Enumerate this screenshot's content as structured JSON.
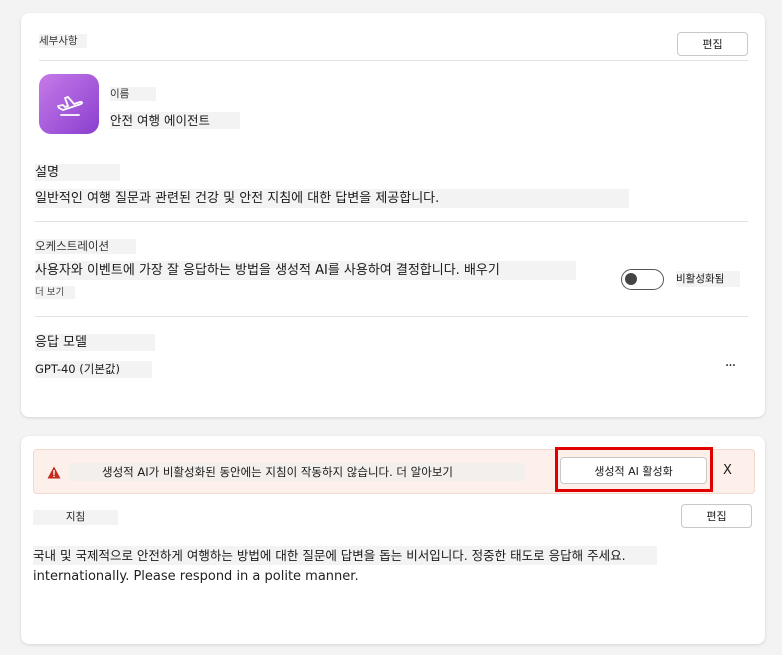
{
  "details": {
    "section_title": "세부사항",
    "edit_button": "편집",
    "name_label": "이름",
    "name_value": "안전 여행 에이전트",
    "description_label": "설명",
    "description_value": "일반적인 여행 질문과 관련된 건강 및 안전 지침에 대한 답변을 제공합니다.",
    "orchestration_label": "오케스트레이션",
    "orchestration_value": "사용자와 이벤트에 가장 잘 응답하는 방법을 생성적 AI를 사용하여 결정합니다. 배우기",
    "more_link": "더 보기",
    "toggle_state_label": "비활성화됨",
    "toggle_on": false,
    "response_model_label": "응답 모델",
    "response_model_value": "GPT-40 (기본값)",
    "more_options": "···",
    "icon": "airplane-icon",
    "icon_gradient": [
      "#c67ae8",
      "#8a3fcf"
    ]
  },
  "guidance": {
    "warning_text": "생성적 AI가 비활성화된 동안에는 지침이 작동하지 않습니다. 더 알아보기",
    "enable_button": "생성적 AI 활성화",
    "close_label": "X",
    "section_title": "지침",
    "edit_button": "편집",
    "text_line1": "국내 및 국제적으로 안전하게 여행하는 방법에 대한 질문에 답변을 돕는 비서입니다. 정중한 태도로 응답해 주세요.",
    "text_line2": "internationally. Please respond in a polite manner.",
    "warning_color": "#c42b1c",
    "highlight_color": "#e00000"
  }
}
